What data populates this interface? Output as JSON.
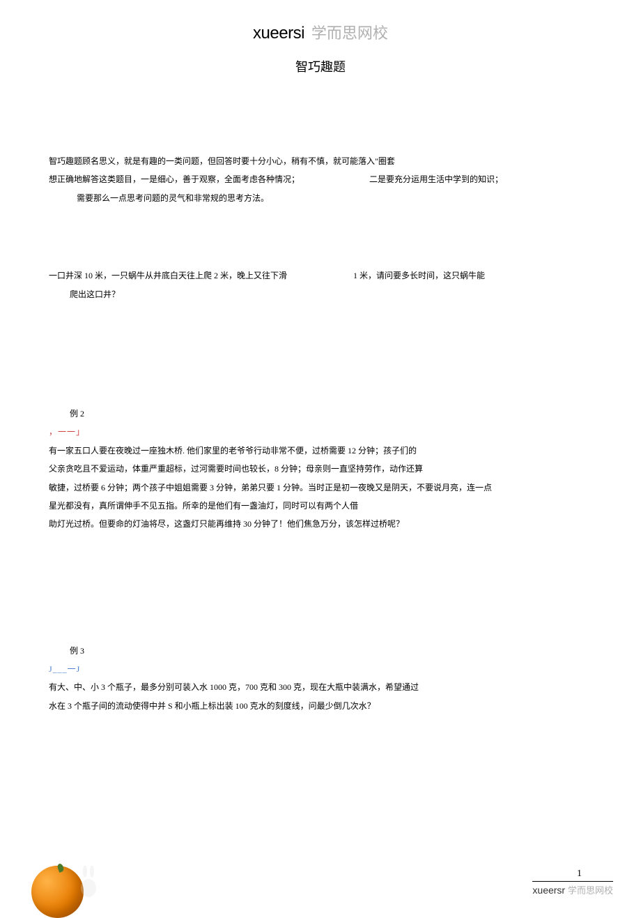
{
  "header": {
    "brand_en": "xueersi",
    "brand_cn": "学而思网校",
    "title": "智巧趣题"
  },
  "intro": {
    "line1": "智巧趣题顾名思义，就是有趣的一类问题，但回答时要十分小心，稍有不慎，就可能落入\"圈套",
    "line2_left": "想正确地解答这类题目，一是细心，善于观察，全面考虑各种情况；",
    "line2_right": "二是要充分运用生活中学到的知识；",
    "line3": "需要那么一点思考问题的灵气和非常规的思考方法。"
  },
  "example1": {
    "line1_left": "一口井深 10 米，一只蜗牛从井底白天往上爬 2 米，晚上又往下滑",
    "line1_right": "1 米，请问要多长时间，这只蜗牛能",
    "line2": "爬出这口井？"
  },
  "example2": {
    "label": "例 2",
    "marker": "，一一」",
    "line1": "有一家五口人要在夜晚过一座独木桥. 他们家里的老爷爷行动非常不便，过桥需要 12 分钟；孩子们的",
    "line2": "父亲贪吃且不爱运动，体重严重超标，过河需要时间也较长，8 分钟；母亲则一直坚持劳作，动作还算",
    "line3": "敏捷，过桥要 6 分钟；两个孩子中姐姐需要 3 分钟，弟弟只要 1 分钟。当时正是初一夜晚又是阴天，不要说月亮，连一点",
    "line4": "星光都没有，真所谓伸手不见五指。所幸的是他们有一盏油灯，同时可以有两个人借",
    "line5": "助灯光过桥。但要命的灯油将尽，这盏灯只能再维持 30 分钟了！他们焦急万分，该怎样过桥呢？"
  },
  "example3": {
    "label": "例 3",
    "marker": "J___一J",
    "line1": "有大、中、小 3 个瓶子，最多分别可装入水 1000 克，700 克和 300 克，现在大瓶中装满水，希望通过",
    "line2": "水在 3 个瓶子间的流动使得中并 S 和小瓶上标出装 100 克水的刻度线，问最少倒几次水？"
  },
  "footer": {
    "page_number": "1",
    "brand_en": "xueersr",
    "brand_cn": "学而思网校"
  }
}
